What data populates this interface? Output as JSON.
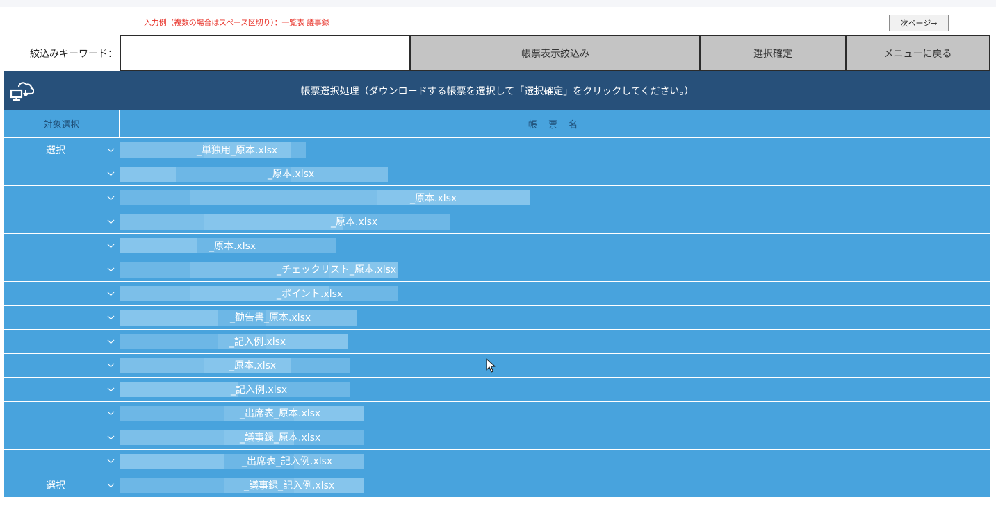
{
  "hint": "入力例（複数の場合はスペース区切り）：一覧表 議事録",
  "next_page": "次ページ→",
  "keyword_label": "絞込みキーワード：",
  "keyword_value": "",
  "buttons": {
    "filter": "帳票表示絞込み",
    "confirm": "選択確定",
    "menu": "メニューに戻る"
  },
  "panel_title": "帳票選択処理（ダウンロードする帳票を選択して「選択確定」をクリックしてください。）",
  "columns": {
    "select": "対象選択",
    "name": "帳 票 名"
  },
  "colors": {
    "header": "#27507a",
    "row": "#48a3dd",
    "button": "#c4c4c4",
    "hint": "#e8342b"
  },
  "icons": {
    "panel": "cloud-computer-icon",
    "dropdown": "chevron-down-icon"
  },
  "rows": [
    {
      "select": "選択",
      "name": "_単独用_原本.xlsx"
    },
    {
      "select": "",
      "name": "_原本.xlsx"
    },
    {
      "select": "",
      "name": "_原本.xlsx"
    },
    {
      "select": "",
      "name": "_原本.xlsx"
    },
    {
      "select": "",
      "name": "_原本.xlsx"
    },
    {
      "select": "",
      "name": "_チェックリスト_原本.xlsx"
    },
    {
      "select": "",
      "name": "_ポイント.xlsx"
    },
    {
      "select": "",
      "name": "_勧告書_原本.xlsx"
    },
    {
      "select": "",
      "name": "_記入例.xlsx"
    },
    {
      "select": "",
      "name": "_原本.xlsx"
    },
    {
      "select": "",
      "name": "_記入例.xlsx"
    },
    {
      "select": "",
      "name": "_出席表_原本.xlsx"
    },
    {
      "select": "",
      "name": "_議事録_原本.xlsx"
    },
    {
      "select": "",
      "name": "_出席表_記入例.xlsx"
    },
    {
      "select": "選択",
      "name": "_議事録_記入例.xlsx"
    }
  ]
}
